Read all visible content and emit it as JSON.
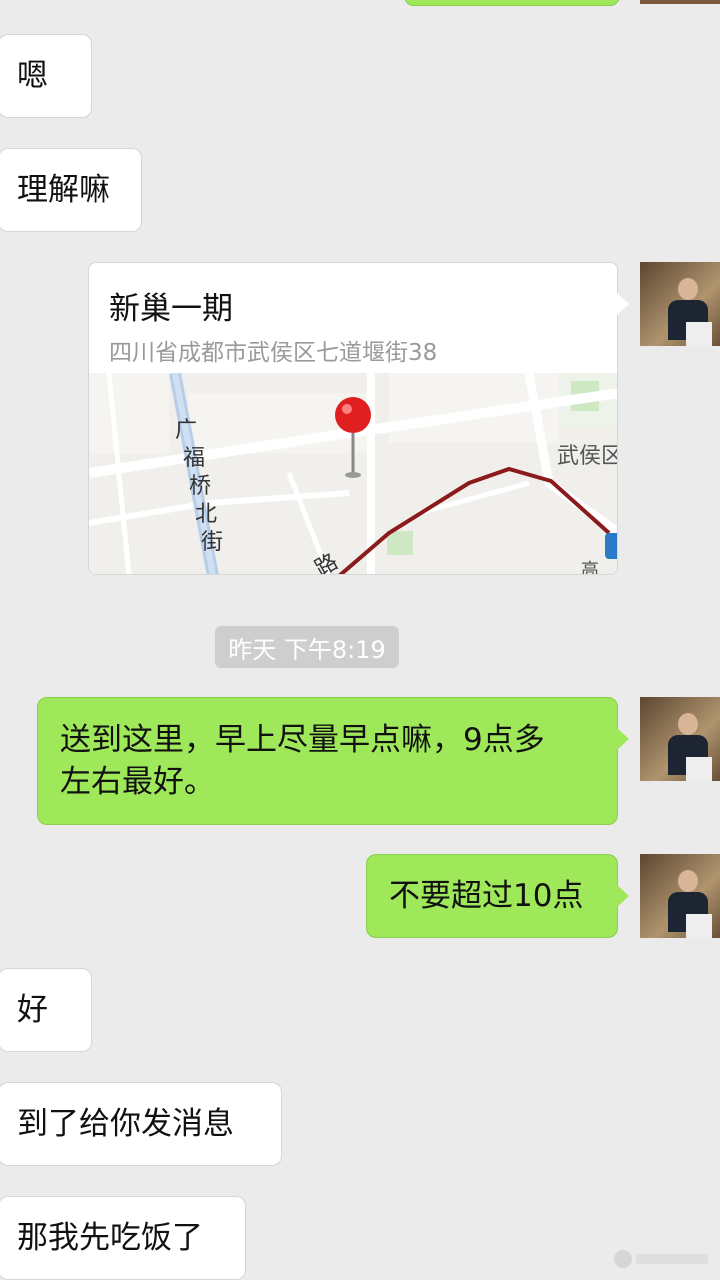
{
  "messages": {
    "m1": "嗯",
    "m2": "理解嘛",
    "location": {
      "title": "新巢一期",
      "address": "四川省成都市武侯区七道堰街38",
      "map_labels": {
        "street_vertical": [
          "广",
          "福",
          "桥",
          "北",
          "街"
        ],
        "district": "武侯区",
        "road_fragment": "路"
      }
    },
    "timestamp": "昨天 下午8:19",
    "m3": "送到这里，早上尽量早点嘛，9点多左右最好。",
    "m3_line1": "送到这里，早上尽量早点嘛，9点多",
    "m3_line2": "左右最好。",
    "m4": "不要超过10点",
    "m5": "好",
    "m6": "到了给你发消息",
    "m7": "那我先吃饭了"
  },
  "colors": {
    "background": "#ebebeb",
    "outgoing_bubble": "#9ee85a",
    "incoming_bubble": "#ffffff",
    "map_route": "#8b1a1a",
    "map_pin": "#e02020"
  },
  "icons": {
    "map_pin": "location-pin-icon",
    "avatar": "user-avatar"
  }
}
